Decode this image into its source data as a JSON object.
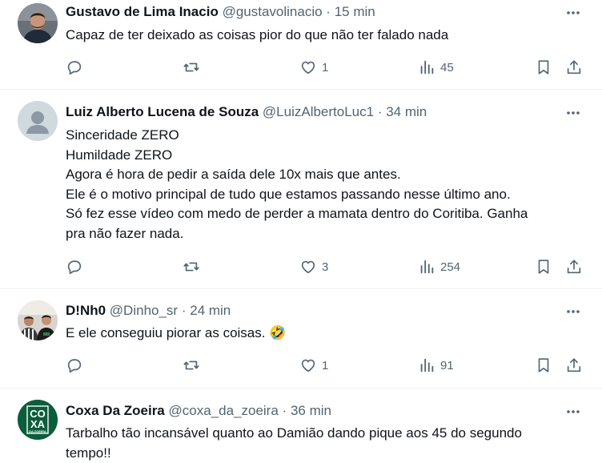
{
  "posts": [
    {
      "name": "Gustavo de Lima Inacio",
      "handle": "@gustavolinacio",
      "dot": "·",
      "time": "15 min",
      "lines": [
        "Capaz de ter deixado as coisas pior do que não ter falado nada"
      ],
      "likes": "1",
      "views": "45",
      "avatar": "photo-dark"
    },
    {
      "name": "Luiz Alberto Lucena de Souza",
      "handle": "@LuizAlbertoLuc1",
      "dot": "·",
      "time": "34 min",
      "lines": [
        "Sinceridade ZERO",
        "Humildade ZERO",
        "Agora é hora de pedir a saída dele 10x mais que antes.",
        "Ele é o motivo principal de tudo que estamos passando nesse último ano.",
        "Só fez esse vídeo com medo de perder a mamata dentro do Coritiba. Ganha",
        "pra não fazer nada."
      ],
      "likes": "3",
      "views": "254",
      "avatar": "default-person"
    },
    {
      "name": "D!Nh0",
      "handle": "@Dinho_sr",
      "dot": "·",
      "time": "24 min",
      "lines": [
        "E ele conseguiu piorar as coisas. 🤣"
      ],
      "likes": "1",
      "views": "91",
      "avatar": "photo-two-people"
    },
    {
      "name": "Coxa Da Zoeira",
      "handle": "@coxa_da_zoeira",
      "dot": "·",
      "time": "36 min",
      "lines": [
        "Tarbalho tão incansável quanto ao Damião dando pique aos 45 do segundo",
        "tempo!!"
      ],
      "avatar": "logo-coxa"
    }
  ],
  "logo": {
    "l1": "CO",
    "l2": "XA",
    "l3": "DA ZOEIRA"
  },
  "colors": {
    "text": "#0f1419",
    "secondary": "#536471",
    "divider": "#eff3f4",
    "logo_green": "#0b5d3b"
  },
  "icons": [
    "more-icon",
    "reply-icon",
    "retweet-icon",
    "like-icon",
    "views-icon",
    "bookmark-icon",
    "share-icon"
  ]
}
